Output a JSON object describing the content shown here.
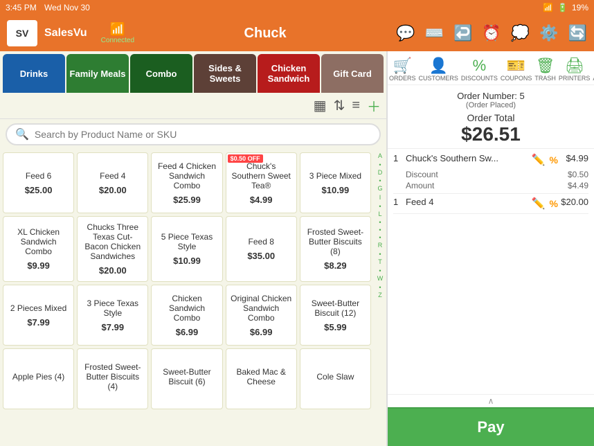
{
  "statusBar": {
    "time": "3:45 PM",
    "day": "Wed Nov 30",
    "battery": "19%"
  },
  "header": {
    "logoText": "SV",
    "appName": "SalesVu",
    "wifiLabel": "Connected",
    "userName": "Chuck"
  },
  "categories": [
    {
      "label": "Drinks",
      "color": "#1a5fa8"
    },
    {
      "label": "Family Meals",
      "color": "#2e7d32"
    },
    {
      "label": "Combo",
      "color": "#1b5e20"
    },
    {
      "label": "Sides & Sweets",
      "color": "#5d4037"
    },
    {
      "label": "Chicken Sandwich",
      "color": "#b71c1c"
    },
    {
      "label": "Gift Card",
      "color": "#8d6e63"
    }
  ],
  "search": {
    "placeholder": "Search by Product Name or SKU"
  },
  "products": [
    {
      "name": "Feed 6",
      "price": "$25.00",
      "discount": false,
      "discountText": ""
    },
    {
      "name": "Feed 4",
      "price": "$20.00",
      "discount": false,
      "discountText": ""
    },
    {
      "name": "Feed 4 Chicken Sandwich Combo",
      "price": "$25.99",
      "discount": false,
      "discountText": ""
    },
    {
      "name": "Chuck's Southern Sweet Tea®",
      "price": "$4.99",
      "discount": true,
      "discountText": "$0.50 OFF"
    },
    {
      "name": "3 Piece Mixed",
      "price": "$10.99",
      "discount": false,
      "discountText": ""
    },
    {
      "name": "XL Chicken Sandwich Combo",
      "price": "$9.99",
      "discount": false,
      "discountText": ""
    },
    {
      "name": "Chucks Three Texas Cut-Bacon Chicken Sandwiches",
      "price": "$20.00",
      "discount": false,
      "discountText": ""
    },
    {
      "name": "5 Piece Texas Style",
      "price": "$10.99",
      "discount": false,
      "discountText": ""
    },
    {
      "name": "Feed 8",
      "price": "$35.00",
      "discount": false,
      "discountText": ""
    },
    {
      "name": "Frosted Sweet-Butter Biscuits (8)",
      "price": "$8.29",
      "discount": false,
      "discountText": ""
    },
    {
      "name": "2 Pieces Mixed",
      "price": "$7.99",
      "discount": false,
      "discountText": ""
    },
    {
      "name": "3 Piece Texas Style",
      "price": "$7.99",
      "discount": false,
      "discountText": ""
    },
    {
      "name": "Chicken Sandwich Combo",
      "price": "$6.99",
      "discount": false,
      "discountText": ""
    },
    {
      "name": "Original Chicken Sandwich Combo",
      "price": "$6.99",
      "discount": false,
      "discountText": ""
    },
    {
      "name": "Sweet-Butter Biscuit (12)",
      "price": "$5.99",
      "discount": false,
      "discountText": ""
    },
    {
      "name": "Apple Pies (4)",
      "price": "",
      "discount": false,
      "discountText": ""
    },
    {
      "name": "Frosted Sweet-Butter Biscuits (4)",
      "price": "",
      "discount": false,
      "discountText": ""
    },
    {
      "name": "Sweet-Butter Biscuit (6)",
      "price": "",
      "discount": false,
      "discountText": ""
    },
    {
      "name": "Baked Mac & Cheese",
      "price": "",
      "discount": false,
      "discountText": ""
    },
    {
      "name": "Cole Slaw",
      "price": "",
      "discount": false,
      "discountText": ""
    }
  ],
  "alphaLetters": [
    "A",
    "•",
    "D",
    "•",
    "G",
    "I",
    "•",
    "L",
    "•",
    "•",
    "•",
    "R",
    "•",
    "T",
    "•",
    "W",
    "•",
    "Z"
  ],
  "orderIcons": [
    {
      "symbol": "🛒",
      "label": "ORDERS"
    },
    {
      "symbol": "👤",
      "label": "CUSTOMERS"
    },
    {
      "symbol": "%",
      "label": "DISCOUNTS"
    },
    {
      "symbol": "🎫",
      "label": "COUPONS"
    },
    {
      "symbol": "🗑",
      "label": "TRASH"
    },
    {
      "symbol": "🖨",
      "label": "PRINTERS"
    },
    {
      "symbol": "★",
      "label": "ATTRIB..."
    }
  ],
  "order": {
    "numberLabel": "Order Number: 5",
    "statusLabel": "(Order Placed)",
    "totalLabel": "Order Total",
    "totalAmount": "$26.51",
    "items": [
      {
        "qty": "1",
        "name": "Chuck's Southern Sw...",
        "price": "$4.99",
        "discount": true,
        "discountLabel": "Discount",
        "discountAmount": "$0.50",
        "amountLabel": "Amount",
        "amountValue": "$4.49"
      },
      {
        "qty": "1",
        "name": "Feed 4",
        "price": "$20.00",
        "discount": false,
        "discountLabel": "",
        "discountAmount": "",
        "amountLabel": "",
        "amountValue": ""
      }
    ],
    "payLabel": "Pay"
  }
}
